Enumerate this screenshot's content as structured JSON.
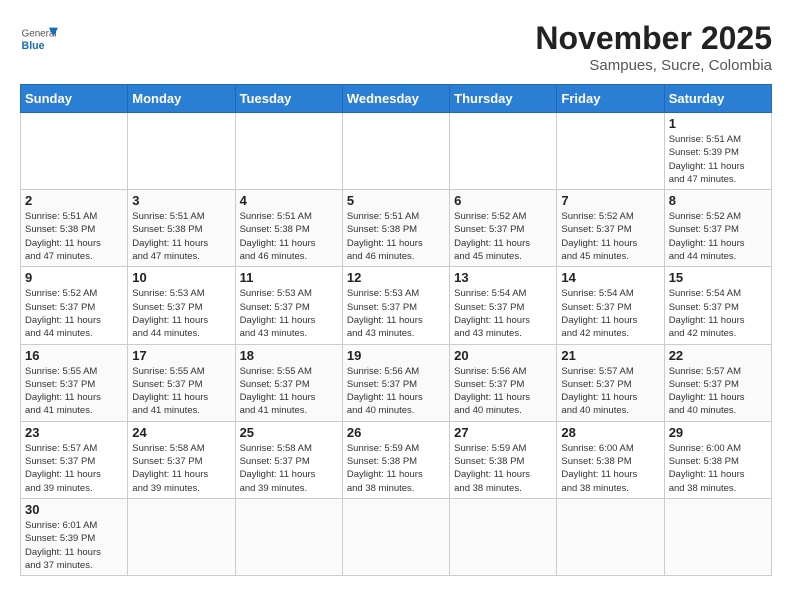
{
  "header": {
    "logo_general": "General",
    "logo_blue": "Blue",
    "month_title": "November 2025",
    "subtitle": "Sampues, Sucre, Colombia"
  },
  "weekdays": [
    "Sunday",
    "Monday",
    "Tuesday",
    "Wednesday",
    "Thursday",
    "Friday",
    "Saturday"
  ],
  "weeks": [
    [
      {
        "day": "",
        "info": ""
      },
      {
        "day": "",
        "info": ""
      },
      {
        "day": "",
        "info": ""
      },
      {
        "day": "",
        "info": ""
      },
      {
        "day": "",
        "info": ""
      },
      {
        "day": "",
        "info": ""
      },
      {
        "day": "1",
        "info": "Sunrise: 5:51 AM\nSunset: 5:39 PM\nDaylight: 11 hours\nand 47 minutes."
      }
    ],
    [
      {
        "day": "2",
        "info": "Sunrise: 5:51 AM\nSunset: 5:38 PM\nDaylight: 11 hours\nand 47 minutes."
      },
      {
        "day": "3",
        "info": "Sunrise: 5:51 AM\nSunset: 5:38 PM\nDaylight: 11 hours\nand 47 minutes."
      },
      {
        "day": "4",
        "info": "Sunrise: 5:51 AM\nSunset: 5:38 PM\nDaylight: 11 hours\nand 46 minutes."
      },
      {
        "day": "5",
        "info": "Sunrise: 5:51 AM\nSunset: 5:38 PM\nDaylight: 11 hours\nand 46 minutes."
      },
      {
        "day": "6",
        "info": "Sunrise: 5:52 AM\nSunset: 5:37 PM\nDaylight: 11 hours\nand 45 minutes."
      },
      {
        "day": "7",
        "info": "Sunrise: 5:52 AM\nSunset: 5:37 PM\nDaylight: 11 hours\nand 45 minutes."
      },
      {
        "day": "8",
        "info": "Sunrise: 5:52 AM\nSunset: 5:37 PM\nDaylight: 11 hours\nand 44 minutes."
      }
    ],
    [
      {
        "day": "9",
        "info": "Sunrise: 5:52 AM\nSunset: 5:37 PM\nDaylight: 11 hours\nand 44 minutes."
      },
      {
        "day": "10",
        "info": "Sunrise: 5:53 AM\nSunset: 5:37 PM\nDaylight: 11 hours\nand 44 minutes."
      },
      {
        "day": "11",
        "info": "Sunrise: 5:53 AM\nSunset: 5:37 PM\nDaylight: 11 hours\nand 43 minutes."
      },
      {
        "day": "12",
        "info": "Sunrise: 5:53 AM\nSunset: 5:37 PM\nDaylight: 11 hours\nand 43 minutes."
      },
      {
        "day": "13",
        "info": "Sunrise: 5:54 AM\nSunset: 5:37 PM\nDaylight: 11 hours\nand 43 minutes."
      },
      {
        "day": "14",
        "info": "Sunrise: 5:54 AM\nSunset: 5:37 PM\nDaylight: 11 hours\nand 42 minutes."
      },
      {
        "day": "15",
        "info": "Sunrise: 5:54 AM\nSunset: 5:37 PM\nDaylight: 11 hours\nand 42 minutes."
      }
    ],
    [
      {
        "day": "16",
        "info": "Sunrise: 5:55 AM\nSunset: 5:37 PM\nDaylight: 11 hours\nand 41 minutes."
      },
      {
        "day": "17",
        "info": "Sunrise: 5:55 AM\nSunset: 5:37 PM\nDaylight: 11 hours\nand 41 minutes."
      },
      {
        "day": "18",
        "info": "Sunrise: 5:55 AM\nSunset: 5:37 PM\nDaylight: 11 hours\nand 41 minutes."
      },
      {
        "day": "19",
        "info": "Sunrise: 5:56 AM\nSunset: 5:37 PM\nDaylight: 11 hours\nand 40 minutes."
      },
      {
        "day": "20",
        "info": "Sunrise: 5:56 AM\nSunset: 5:37 PM\nDaylight: 11 hours\nand 40 minutes."
      },
      {
        "day": "21",
        "info": "Sunrise: 5:57 AM\nSunset: 5:37 PM\nDaylight: 11 hours\nand 40 minutes."
      },
      {
        "day": "22",
        "info": "Sunrise: 5:57 AM\nSunset: 5:37 PM\nDaylight: 11 hours\nand 40 minutes."
      }
    ],
    [
      {
        "day": "23",
        "info": "Sunrise: 5:57 AM\nSunset: 5:37 PM\nDaylight: 11 hours\nand 39 minutes."
      },
      {
        "day": "24",
        "info": "Sunrise: 5:58 AM\nSunset: 5:37 PM\nDaylight: 11 hours\nand 39 minutes."
      },
      {
        "day": "25",
        "info": "Sunrise: 5:58 AM\nSunset: 5:37 PM\nDaylight: 11 hours\nand 39 minutes."
      },
      {
        "day": "26",
        "info": "Sunrise: 5:59 AM\nSunset: 5:38 PM\nDaylight: 11 hours\nand 38 minutes."
      },
      {
        "day": "27",
        "info": "Sunrise: 5:59 AM\nSunset: 5:38 PM\nDaylight: 11 hours\nand 38 minutes."
      },
      {
        "day": "28",
        "info": "Sunrise: 6:00 AM\nSunset: 5:38 PM\nDaylight: 11 hours\nand 38 minutes."
      },
      {
        "day": "29",
        "info": "Sunrise: 6:00 AM\nSunset: 5:38 PM\nDaylight: 11 hours\nand 38 minutes."
      }
    ],
    [
      {
        "day": "30",
        "info": "Sunrise: 6:01 AM\nSunset: 5:39 PM\nDaylight: 11 hours\nand 37 minutes."
      },
      {
        "day": "",
        "info": ""
      },
      {
        "day": "",
        "info": ""
      },
      {
        "day": "",
        "info": ""
      },
      {
        "day": "",
        "info": ""
      },
      {
        "day": "",
        "info": ""
      },
      {
        "day": "",
        "info": ""
      }
    ]
  ]
}
